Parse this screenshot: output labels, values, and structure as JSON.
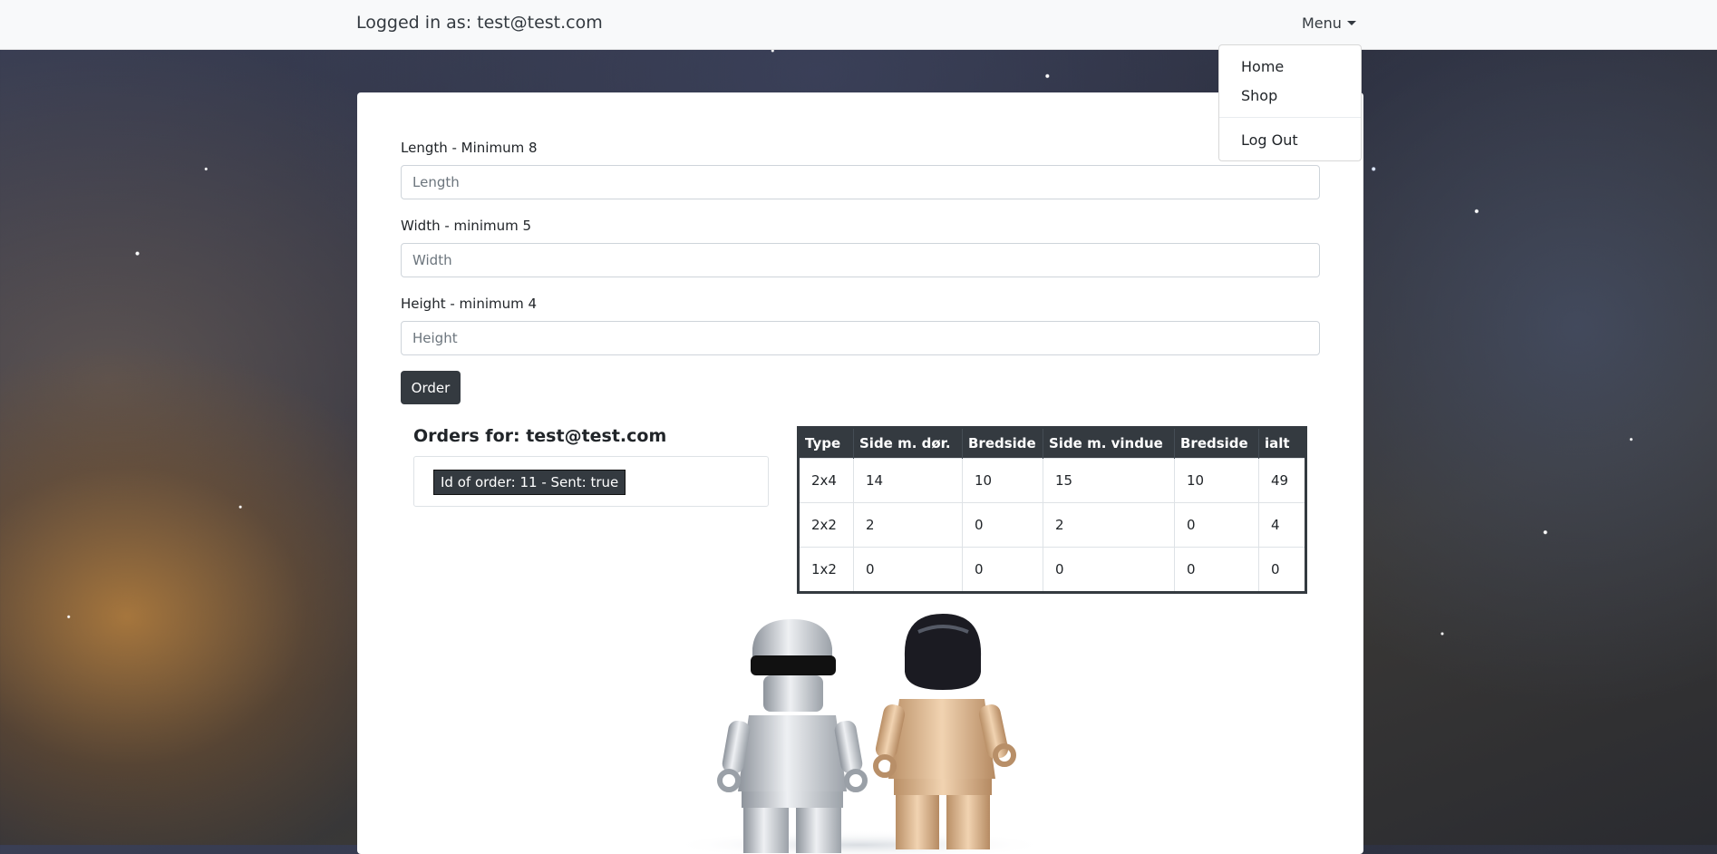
{
  "navbar": {
    "logged_in_text": "Logged in as: test@test.com",
    "menu_label": "Menu"
  },
  "dropdown": {
    "items": [
      {
        "label": "Home"
      },
      {
        "label": "Shop"
      },
      {
        "label": "Log Out"
      }
    ]
  },
  "form": {
    "length_label": "Length - Minimum 8",
    "length_placeholder": "Length",
    "width_label": "Width - minimum 5",
    "width_placeholder": "Width",
    "height_label": "Height - minimum 4",
    "height_placeholder": "Height",
    "order_button": "Order"
  },
  "orders": {
    "title": "Orders for: test@test.com",
    "items": [
      {
        "label": "Id of order: 11 - Sent: true"
      }
    ]
  },
  "bom_table": {
    "headers": [
      "Type",
      "Side m. dør.",
      "Bredside",
      "Side m. vindue",
      "Bredside",
      "ialt"
    ],
    "rows": [
      [
        "2x4",
        "14",
        "10",
        "15",
        "10",
        "49"
      ],
      [
        "2x2",
        "2",
        "0",
        "2",
        "0",
        "4"
      ],
      [
        "1x2",
        "0",
        "0",
        "0",
        "0",
        "0"
      ]
    ]
  },
  "image": {
    "icon": "lego-figures-image",
    "colors": {
      "silver": "#c8ccd2",
      "gold": "#d9b38a"
    }
  }
}
